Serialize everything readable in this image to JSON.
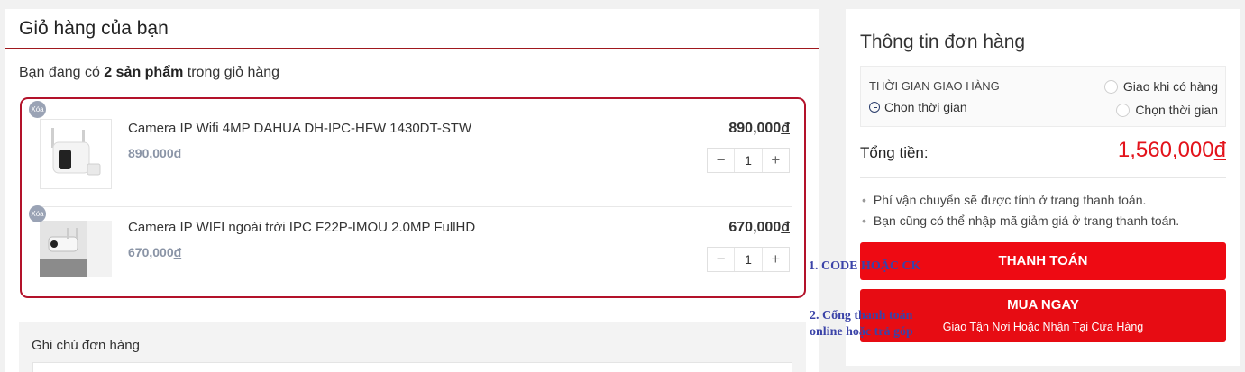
{
  "cart": {
    "title": "Giỏ hàng của bạn",
    "subtitle_prefix": "Bạn đang có ",
    "subtitle_count": "2 sản phẩm",
    "subtitle_suffix": " trong giỏ hàng",
    "items": [
      {
        "name": "Camera IP Wifi 4MP DAHUA DH-IPC-HFW 1430DT-STW",
        "unit_price": "890,000",
        "price": "890,000",
        "currency": "đ",
        "quantity": "1",
        "delete_label": "Xóa",
        "image_icon": "camera-bullet-white"
      },
      {
        "name": "Camera IP WIFI ngoài trời IPC F22P-IMOU 2.0MP FullHD",
        "unit_price": "670,000",
        "price": "670,000",
        "currency": "đ",
        "quantity": "1",
        "delete_label": "Xóa",
        "image_icon": "camera-outdoor-photo"
      }
    ],
    "qty_minus": "−",
    "qty_plus": "+",
    "note_label": "Ghi chú đơn hàng"
  },
  "order": {
    "title": "Thông tin đơn hàng",
    "delivery_label": "THỜI GIAN GIAO HÀNG",
    "delivery_pick": "Chọn thời gian",
    "options": [
      "Giao khi có hàng",
      "Chọn thời gian"
    ],
    "total_label": "Tổng tiền:",
    "total_value": "1,560,000",
    "currency": "đ",
    "notes": [
      "Phí vận chuyển sẽ được tính ở trang thanh toán.",
      "Bạn cũng có thể nhập mã giảm giá ở trang thanh toán."
    ],
    "pay_button": "THANH TOÁN",
    "buy_button": "MUA NGAY",
    "buy_button_sub": "Giao Tận Nơi Hoặc Nhận Tại Cửa Hàng"
  },
  "annotations": {
    "first": "1. CODE HOẶC CK",
    "second_line1": "2. Cổng thanh toán",
    "second_line2": "online hoặc trả góp"
  },
  "colors": {
    "accent_red": "#ee0a13",
    "price_red": "#e3131b",
    "border_red": "#b3122a",
    "overlay_blue": "#3b43a8"
  }
}
